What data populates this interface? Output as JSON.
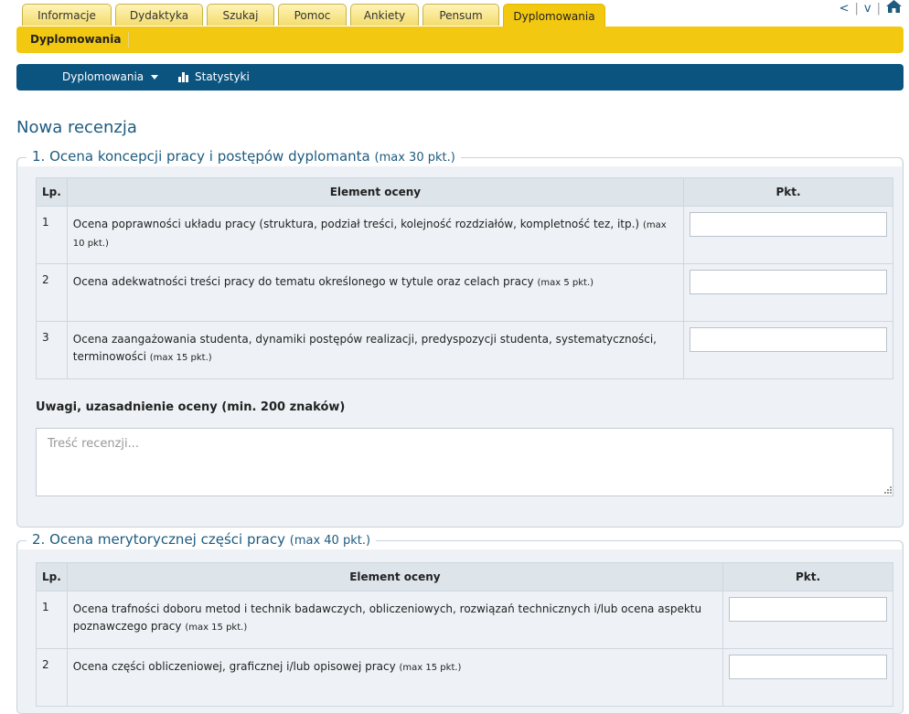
{
  "tabs": [
    {
      "label": "Informacje",
      "active": false
    },
    {
      "label": "Dydaktyka",
      "active": false
    },
    {
      "label": "Szukaj",
      "active": false
    },
    {
      "label": "Pomoc",
      "active": false
    },
    {
      "label": "Ankiety",
      "active": false
    },
    {
      "label": "Pensum",
      "active": false
    },
    {
      "label": "Dyplomowania",
      "active": true
    }
  ],
  "topnav": {
    "prev": "<",
    "sep": "|",
    "next": "v",
    "home_icon": "home-icon"
  },
  "subbar": {
    "label": "Dyplomowania"
  },
  "menu": {
    "dropdown_label": "Dyplomowania",
    "stats_label": "Statystyki"
  },
  "page_title": "Nowa recenzja",
  "section1": {
    "title": "1. Ocena koncepcji pracy i postępów dyplomanta",
    "max": "(max 30 pkt.)",
    "headers": {
      "lp": "Lp.",
      "element": "Element oceny",
      "pkt": "Pkt."
    },
    "rows": [
      {
        "lp": "1",
        "text": "Ocena poprawności układu pracy (struktura, podział treści, kolejność rozdziałów, kompletność tez, itp.)",
        "max": "(max 10 pkt.)",
        "value": ""
      },
      {
        "lp": "2",
        "text": "Ocena adekwatności treści pracy do tematu określonego w tytule oraz celach pracy",
        "max": "(max 5 pkt.)",
        "value": ""
      },
      {
        "lp": "3",
        "text": "Ocena zaangażowania studenta, dynamiki postępów realizacji, predyspozycji studenta, systematyczności, terminowości",
        "max": "(max 15 pkt.)",
        "value": ""
      }
    ],
    "notes_label": "Uwagi, uzasadnienie oceny (min. 200 znaków)",
    "notes_placeholder": "Treść recenzji...",
    "notes_value": ""
  },
  "section2": {
    "title": "2. Ocena merytorycznej części pracy",
    "max": "(max 40 pkt.)",
    "headers": {
      "lp": "Lp.",
      "element": "Element oceny",
      "pkt": "Pkt."
    },
    "rows": [
      {
        "lp": "1",
        "text": "Ocena trafności doboru metod i technik badawczych, obliczeniowych, rozwiązań technicznych i/lub ocena aspektu poznawczego pracy",
        "max": "(max 15 pkt.)",
        "value": ""
      },
      {
        "lp": "2",
        "text": "Ocena części obliczeniowej, graficznej i/lub opisowej pracy",
        "max": "(max 15 pkt.)",
        "value": ""
      }
    ]
  }
}
